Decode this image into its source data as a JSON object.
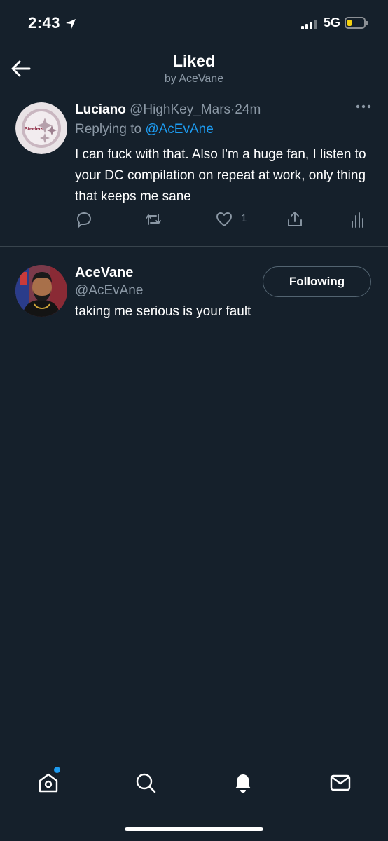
{
  "status_bar": {
    "time": "2:43",
    "network": "5G",
    "battery_level": 0.25,
    "battery_color": "#f5d20f"
  },
  "header": {
    "title": "Liked",
    "subtitle": "by AceVane"
  },
  "tweet": {
    "avatar_text": "Steelers",
    "name": "Luciano",
    "handle": "@HighKey_Mars",
    "separator": "·",
    "time": "24m",
    "replying_label": "Replying to",
    "replying_handle": "@AcEvAne",
    "text": "I can fuck with that. Also I'm a huge fan, I listen to your DC compilation on repeat at work, only thing that keeps me sane",
    "like_count": "1",
    "icons": [
      "reply-icon",
      "retweet-icon",
      "like-icon",
      "share-icon",
      "analytics-icon"
    ]
  },
  "liker": {
    "name": "AceVane",
    "handle": "@AcEvAne",
    "bio": "taking me serious is your fault",
    "follow_label": "Following"
  },
  "bottom_nav": {
    "items": [
      "home-icon",
      "search-icon",
      "notifications-icon",
      "messages-icon"
    ],
    "accent": "#1d9bf0"
  }
}
